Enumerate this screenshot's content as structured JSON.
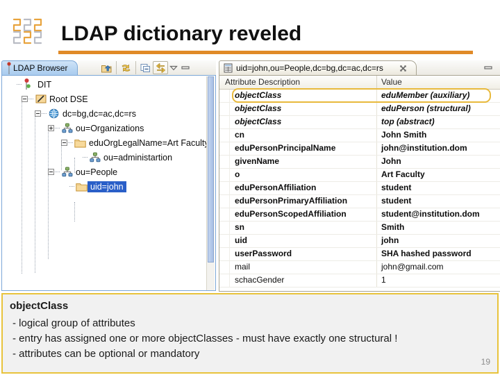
{
  "slide": {
    "title": "LDAP dictionary reveled",
    "page_number": "19",
    "accent_color": "#e08a28",
    "caption_border_color": "#e8c33b",
    "highlight_color": "#e8b93b",
    "selection_color": "#2a5fc8"
  },
  "logo": {
    "name": "company-logo"
  },
  "left_panel": {
    "tab_label": "LDAP Browser",
    "toolbar": [
      {
        "name": "open-folder-up-icon",
        "label": "Open folder"
      },
      {
        "name": "refresh-icon",
        "label": "Refresh"
      },
      {
        "name": "collapse-all-icon",
        "label": "Collapse All"
      },
      {
        "name": "link-with-editor-icon",
        "label": "Link with Editor",
        "active": true
      },
      {
        "name": "view-menu-chevron-icon",
        "label": "View Menu"
      },
      {
        "name": "minimize-icon",
        "label": "Minimize"
      }
    ],
    "tree": [
      {
        "label": "DIT",
        "depth": 0,
        "icon": "dit-icon",
        "expander": "none",
        "selected": false
      },
      {
        "label": "Root DSE",
        "depth": 1,
        "icon": "rootdse-icon",
        "expander": "minus",
        "selected": false
      },
      {
        "label": "dc=bg,dc=ac,dc=rs",
        "depth": 2,
        "icon": "globe-icon",
        "expander": "minus",
        "selected": false
      },
      {
        "label": "ou=Organizations",
        "depth": 3,
        "icon": "org-icon",
        "expander": "plus",
        "selected": false
      },
      {
        "label": "eduOrgLegalName=Art Faculty",
        "depth": 4,
        "icon": "folder-icon",
        "expander": "minus",
        "selected": false
      },
      {
        "label": "ou=administartion",
        "depth": 5,
        "icon": "org-icon",
        "expander": "none",
        "selected": false
      },
      {
        "label": "ou=People",
        "depth": 3,
        "icon": "org-icon",
        "expander": "minus",
        "selected": false
      },
      {
        "label": "uid=john",
        "depth": 4,
        "icon": "folder-icon",
        "expander": "none",
        "selected": true
      }
    ]
  },
  "right_panel": {
    "tab_label": "uid=john,ou=People,dc=bg,dc=ac,dc=rs",
    "tab_icon": "entry-editor-icon",
    "close_label": "Close",
    "minimize_label": "Minimize",
    "columns": [
      "Attribute Description",
      "Value"
    ],
    "rows": [
      {
        "attribute": "objectClass",
        "value": "eduMember (auxiliary)",
        "style": "objectclass",
        "highlighted": true
      },
      {
        "attribute": "objectClass",
        "value": "eduPerson (structural)",
        "style": "objectclass",
        "highlighted": false
      },
      {
        "attribute": "objectClass",
        "value": "top (abstract)",
        "style": "objectclass",
        "highlighted": false
      },
      {
        "attribute": "cn",
        "value": "John Smith",
        "style": "bold",
        "highlighted": false
      },
      {
        "attribute": "eduPersonPrincipalName",
        "value": "john@institution.dom",
        "style": "bold",
        "highlighted": false
      },
      {
        "attribute": "givenName",
        "value": "John",
        "style": "bold",
        "highlighted": false
      },
      {
        "attribute": "o",
        "value": "Art Faculty",
        "style": "bold",
        "highlighted": false
      },
      {
        "attribute": "eduPersonAffiliation",
        "value": "student",
        "style": "bold",
        "highlighted": false
      },
      {
        "attribute": "eduPersonPrimaryAffiliation",
        "value": "student",
        "style": "bold",
        "highlighted": false
      },
      {
        "attribute": "eduPersonScopedAffiliation",
        "value": "student@institution.dom",
        "style": "bold",
        "highlighted": false
      },
      {
        "attribute": "sn",
        "value": "Smith",
        "style": "bold",
        "highlighted": false
      },
      {
        "attribute": "uid",
        "value": "john",
        "style": "bold",
        "highlighted": false
      },
      {
        "attribute": "userPassword",
        "value": "SHA hashed password",
        "style": "bold",
        "highlighted": false
      },
      {
        "attribute": "mail",
        "value": "john@gmail.com",
        "style": "normal",
        "highlighted": false
      },
      {
        "attribute": "schacGender",
        "value": "1",
        "style": "normal",
        "highlighted": false
      }
    ]
  },
  "caption": {
    "title": "objectClass",
    "line1": "- logical group of attributes",
    "line2": "- entry has assigned one or more objectClasses - must have exactly one structural !",
    "line3": "- attributes can be optional or mandatory"
  }
}
